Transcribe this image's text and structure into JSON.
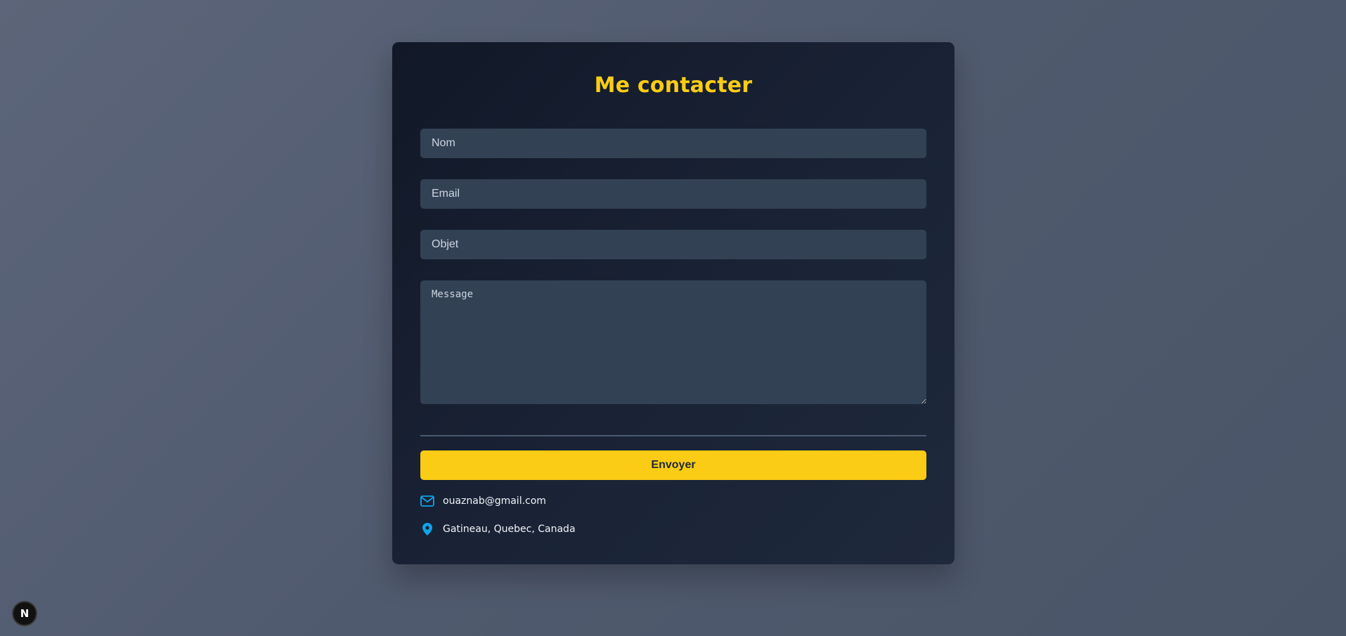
{
  "contact": {
    "title": "Me contacter",
    "fields": {
      "name_placeholder": "Nom",
      "email_placeholder": "Email",
      "subject_placeholder": "Objet",
      "message_placeholder": "Message"
    },
    "submit_label": "Envoyer",
    "info": {
      "email": "ouaznab@gmail.com",
      "location": "Gatineau, Quebec, Canada"
    }
  },
  "icons": {
    "email": "mail-icon",
    "location": "map-pin-icon",
    "framework": "nextjs-icon"
  },
  "badge": {
    "letter": "N"
  },
  "colors": {
    "accent": "#facc15",
    "card_background": "#1e293b",
    "input_background": "#334155",
    "icon_blue": "#0ea5e9",
    "page_background": "#556075"
  }
}
